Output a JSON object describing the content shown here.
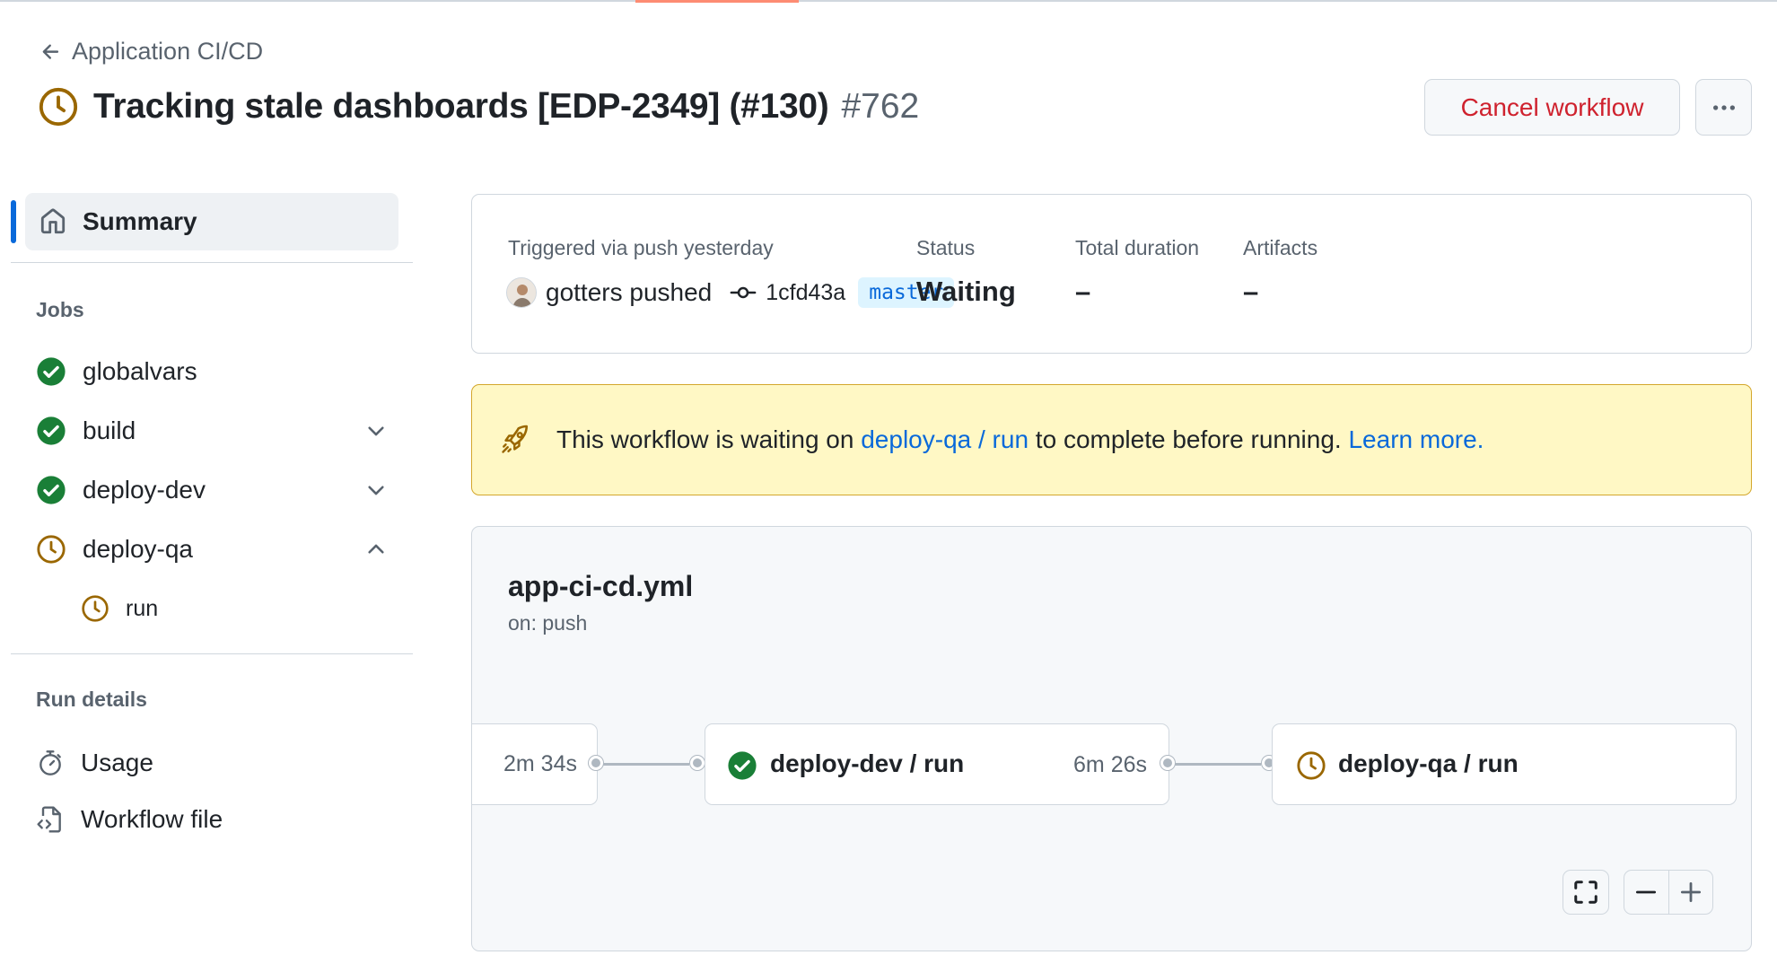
{
  "header": {
    "back_label": "Application CI/CD",
    "title": "Tracking stale dashboards [EDP-2349] (#130)",
    "run_number": "#762",
    "cancel_label": "Cancel workflow"
  },
  "sidebar": {
    "summary_label": "Summary",
    "jobs_heading": "Jobs",
    "jobs": [
      {
        "label": "globalvars",
        "status": "success"
      },
      {
        "label": "build",
        "status": "success"
      },
      {
        "label": "deploy-dev",
        "status": "success"
      },
      {
        "label": "deploy-qa",
        "status": "waiting"
      }
    ],
    "sub_job": "run",
    "details_heading": "Run details",
    "usage_label": "Usage",
    "workflow_file_label": "Workflow file"
  },
  "summary": {
    "trigger_label": "Triggered via push yesterday",
    "actor_text": "gotters pushed",
    "commit_sha": "1cfd43a",
    "branch": "master",
    "status_label": "Status",
    "status_value": "Waiting",
    "duration_label": "Total duration",
    "duration_value": "–",
    "artifacts_label": "Artifacts",
    "artifacts_value": "–"
  },
  "banner": {
    "prefix": "This workflow is waiting on ",
    "link": "deploy-qa / run",
    "middle": " to complete before running. ",
    "learn_more": "Learn more."
  },
  "graph": {
    "workflow_file": "app-ci-cd.yml",
    "trigger": "on: push",
    "prev_duration": "2m 34s",
    "nodes": [
      {
        "name": "deploy-dev / run",
        "duration": "6m 26s",
        "status": "success"
      },
      {
        "name": "deploy-qa / run",
        "status": "waiting"
      }
    ]
  },
  "colors": {
    "success": "#1a7f37",
    "waiting": "#9a6700",
    "danger": "#cf222e",
    "link": "#0969da"
  }
}
